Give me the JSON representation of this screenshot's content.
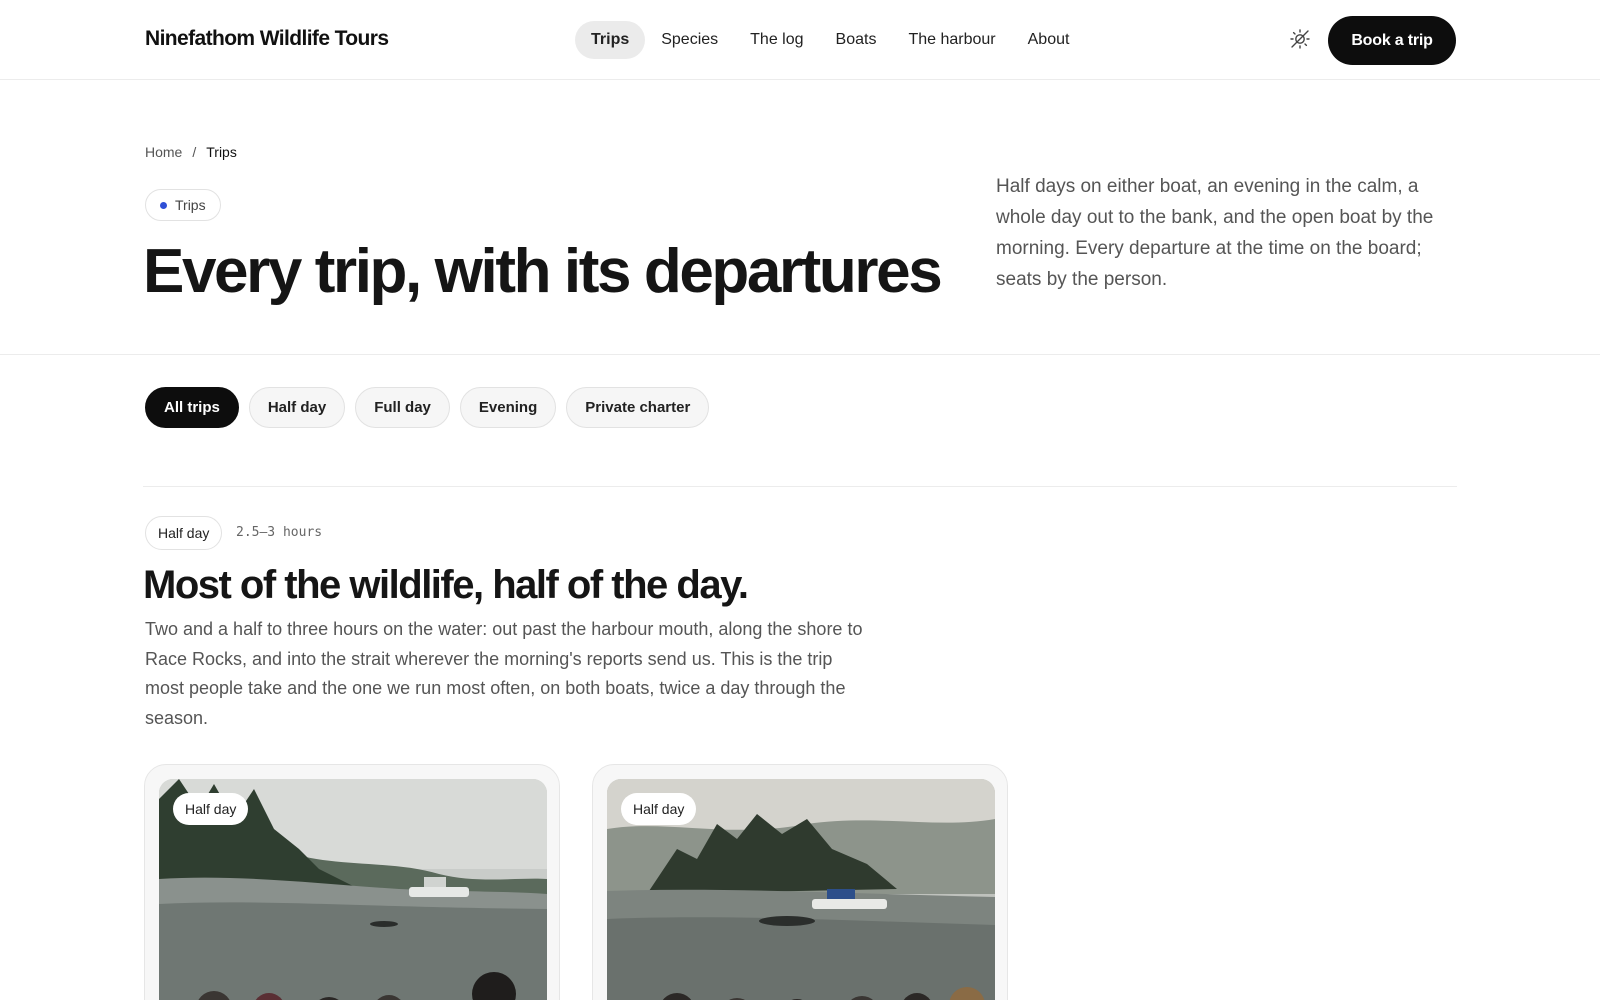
{
  "header": {
    "brand": "Ninefathom Wildlife Tours",
    "nav": [
      "Trips",
      "Species",
      "The log",
      "Boats",
      "The harbour",
      "About"
    ],
    "active_nav": "Trips",
    "cta": "Book a trip"
  },
  "hero": {
    "breadcrumb": {
      "home": "Home",
      "separator": "/",
      "current": "Trips"
    },
    "pill": "Trips",
    "title": "Every trip, with its departures",
    "description": "Half days on either boat, an evening in the calm, a whole day out to the bank, and the open boat by the morning. Every departure at the time on the board; seats by the person."
  },
  "filters": [
    "All trips",
    "Half day",
    "Full day",
    "Evening",
    "Private charter"
  ],
  "active_filter": "All trips",
  "section": {
    "badge": "Half day",
    "duration": "2.5–3 hours",
    "title": "Most of the wildlife, half of the day.",
    "description": "Two and a half to three hours on the water: out past the harbour mouth, along the shore to Race Rocks, and into the strait wherever the morning's reports send us. This is the trip most people take and the one we run most often, on both boats, twice a day through the season."
  },
  "cards": [
    {
      "badge": "Half day"
    },
    {
      "badge": "Half day"
    }
  ],
  "colors": {
    "accent_dot": "#2f4fd6",
    "primary_button": "#0d0d0d"
  }
}
